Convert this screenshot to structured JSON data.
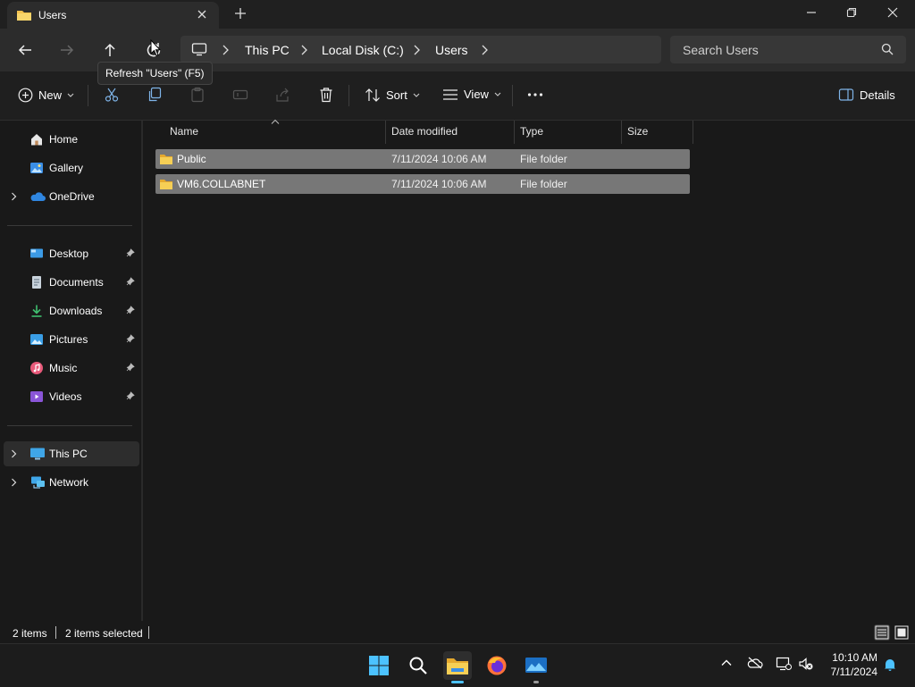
{
  "window": {
    "tab_title": "Users",
    "tab_icon": "folder-icon"
  },
  "address": {
    "crumbs": [
      "This PC",
      "Local Disk (C:)",
      "Users"
    ],
    "search_placeholder": "Search Users",
    "tooltip": "Refresh \"Users\" (F5)"
  },
  "commands": {
    "new_label": "New",
    "sort_label": "Sort",
    "view_label": "View",
    "details_label": "Details"
  },
  "sidebar": {
    "items": [
      {
        "label": "Home",
        "icon": "home-icon"
      },
      {
        "label": "Gallery",
        "icon": "gallery-icon"
      },
      {
        "label": "OneDrive",
        "icon": "onedrive-icon"
      },
      {
        "label": "Desktop",
        "icon": "desktop-icon"
      },
      {
        "label": "Documents",
        "icon": "documents-icon"
      },
      {
        "label": "Downloads",
        "icon": "downloads-icon"
      },
      {
        "label": "Pictures",
        "icon": "pictures-icon"
      },
      {
        "label": "Music",
        "icon": "music-icon"
      },
      {
        "label": "Videos",
        "icon": "videos-icon"
      },
      {
        "label": "This PC",
        "icon": "this-pc-icon"
      },
      {
        "label": "Network",
        "icon": "network-icon"
      }
    ]
  },
  "files": {
    "columns": [
      "Name",
      "Date modified",
      "Type",
      "Size"
    ],
    "rows": [
      {
        "name": "Public",
        "date": "7/11/2024 10:06 AM",
        "type": "File folder",
        "size": ""
      },
      {
        "name": "VM6.COLLABNET",
        "date": "7/11/2024 10:06 AM",
        "type": "File folder",
        "size": ""
      }
    ]
  },
  "status": {
    "count": "2 items",
    "selected": "2 items selected"
  },
  "taskbar": {
    "time": "10:10 AM",
    "date": "7/11/2024"
  },
  "colors": {
    "folder": "#f2c14e",
    "selection": "#777777",
    "accent": "#4cc2ff"
  }
}
